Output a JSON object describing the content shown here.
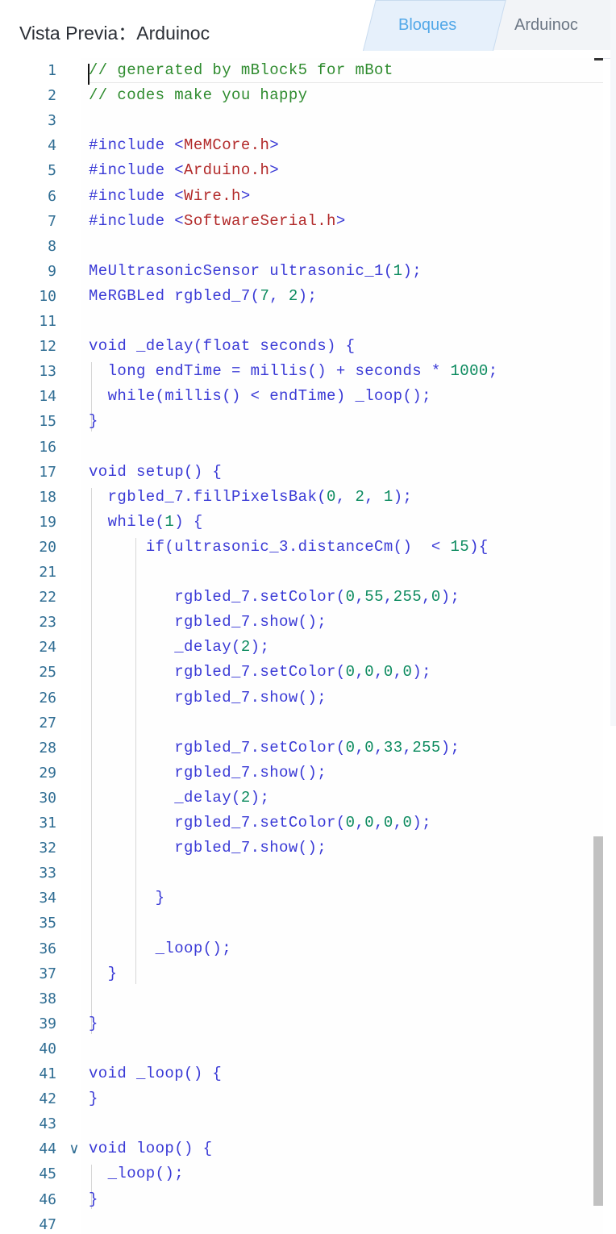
{
  "header": {
    "title": "Vista Previa：Arduinoc",
    "tabs": [
      {
        "label": "Bloques",
        "active": true
      },
      {
        "label": "Arduinoc",
        "active": false
      }
    ]
  },
  "colors": {
    "keyword": "#3a3ad6",
    "comment": "#2e8b2e",
    "string": "#b22a2a",
    "number": "#0b8a5e",
    "line_number": "#2f6d93",
    "active_tab": "#52a8e8"
  },
  "editor": {
    "lines": [
      "// generated by mBlock5 for mBot",
      "// codes make you happy",
      "",
      "#include <MeMCore.h>",
      "#include <Arduino.h>",
      "#include <Wire.h>",
      "#include <SoftwareSerial.h>",
      "",
      "MeUltrasonicSensor ultrasonic_1(1);",
      "MeRGBLed rgbled_7(7, 2);",
      "",
      "void _delay(float seconds) {",
      "  long endTime = millis() + seconds * 1000;",
      "  while(millis() < endTime) _loop();",
      "}",
      "",
      "void setup() {",
      "  rgbled_7.fillPixelsBak(0, 2, 1);",
      "  while(1) {",
      "      if(ultrasonic_3.distanceCm()  < 15){",
      "",
      "         rgbled_7.setColor(0,55,255,0);",
      "         rgbled_7.show();",
      "         _delay(2);",
      "         rgbled_7.setColor(0,0,0,0);",
      "         rgbled_7.show();",
      "",
      "         rgbled_7.setColor(0,0,33,255);",
      "         rgbled_7.show();",
      "         _delay(2);",
      "         rgbled_7.setColor(0,0,0,0);",
      "         rgbled_7.show();",
      "",
      "       }",
      "",
      "       _loop();",
      "  }",
      "",
      "}",
      "",
      "void _loop() {",
      "}",
      "",
      "void loop() {",
      "  _loop();",
      "}",
      ""
    ],
    "fold_icon": "chevron-down-icon"
  }
}
